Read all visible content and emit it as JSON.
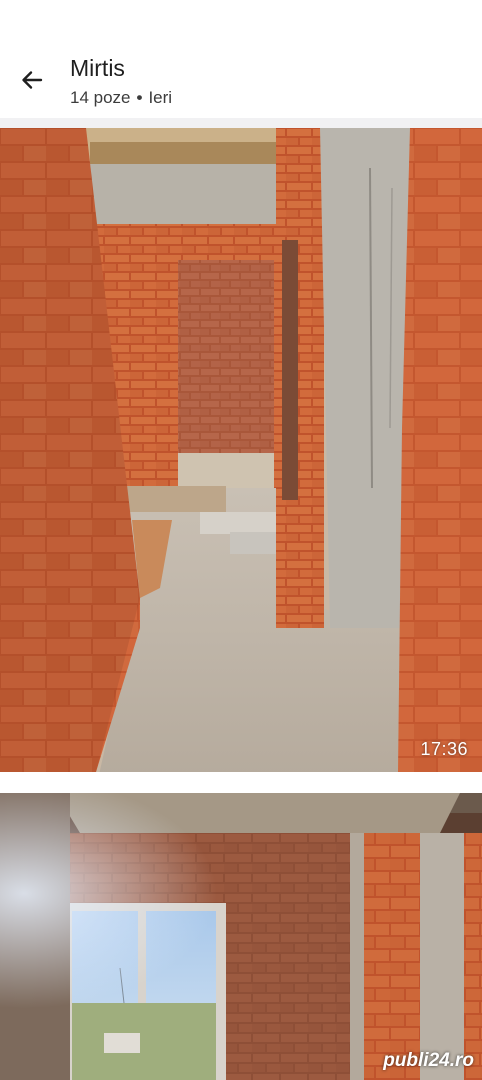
{
  "header": {
    "title": "Mirtis",
    "photo_count": "14 poze",
    "separator": "•",
    "date": "Ieri"
  },
  "photos": [
    {
      "timestamp": "17:36"
    },
    {
      "watermark": "publi24.ro"
    }
  ],
  "icons": {
    "back": "arrow-left-icon"
  },
  "colors": {
    "text": "#1f1f1f",
    "brick": "#c0552e",
    "concrete": "#b9b5ad"
  }
}
